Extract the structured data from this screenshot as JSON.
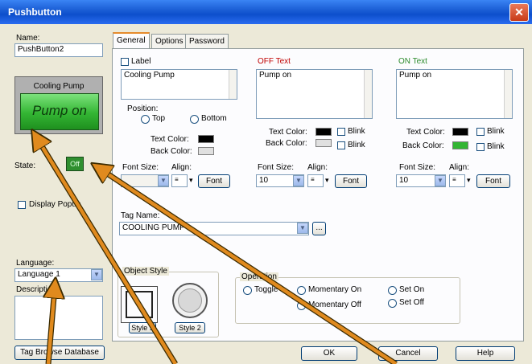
{
  "window": {
    "title": "Pushbutton"
  },
  "left": {
    "name_label": "Name:",
    "name_value": "PushButton2",
    "preview_top_label": "Cooling Pump",
    "preview_main_label": "Pump on",
    "state_label": "State:",
    "state_value": "Off",
    "display_label": "Display Popup",
    "language_label": "Language:",
    "language_value": "Language 1",
    "description_label": "Description:",
    "tag_button": "Tag Browse Database"
  },
  "tabs": [
    "General",
    "Options",
    "Password"
  ],
  "label_section": {
    "checkbox": "Label",
    "text": "Cooling Pump",
    "position_label": "Position:",
    "top": "Top",
    "bottom": "Bottom",
    "text_color": "Text Color:",
    "back_color": "Back Color:",
    "font_size_label": "Font Size:",
    "align_label": "Align:",
    "font_button": "Font"
  },
  "off_section": {
    "title": "OFF Text",
    "text": "Pump on",
    "text_color": "Text Color:",
    "back_color": "Back Color:",
    "blink": "Blink",
    "font_size_label": "Font Size:",
    "font_size": "10",
    "align_label": "Align:",
    "font_button": "Font"
  },
  "on_section": {
    "title": "ON Text",
    "text": "Pump on",
    "text_color": "Text Color:",
    "back_color": "Back Color:",
    "blink": "Blink",
    "font_size_label": "Font Size:",
    "font_size": "10",
    "align_label": "Align:",
    "font_button": "Font"
  },
  "tag": {
    "label": "Tag Name:",
    "value": "COOLING PUMP"
  },
  "object_style": {
    "title": "Object Style",
    "style1": "Style 1",
    "style2": "Style 2"
  },
  "operation": {
    "title": "Operation",
    "toggle": "Toggle",
    "momentary_on": "Momentary On",
    "momentary_off": "Momentary Off",
    "set_on": "Set On",
    "set_off": "Set Off"
  },
  "buttons": {
    "ok": "OK",
    "cancel": "Cancel",
    "help": "Help"
  },
  "colors": {
    "title_bar": "#1c5fd6",
    "pump_green": "#33b533",
    "arrow": "#e08a1e",
    "arrow_outline": "#3a2a00"
  }
}
